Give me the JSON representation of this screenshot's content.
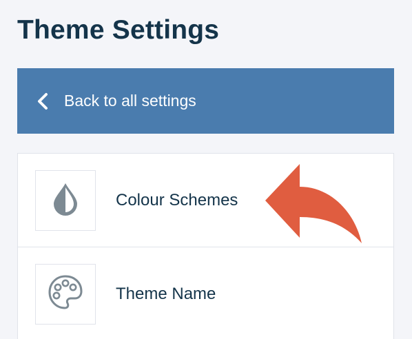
{
  "page": {
    "title": "Theme Settings"
  },
  "back": {
    "label": "Back to all settings",
    "icon": "chevron-left-icon"
  },
  "settings": {
    "items": [
      {
        "label": "Colour Schemes",
        "icon": "droplet-icon"
      },
      {
        "label": "Theme Name",
        "icon": "palette-icon"
      }
    ]
  },
  "annotation": {
    "arrow_color": "#e05d40"
  },
  "colors": {
    "accent": "#4a7cae",
    "title": "#14344a",
    "background": "#f4f5f9",
    "icon": "#7d8a93"
  }
}
